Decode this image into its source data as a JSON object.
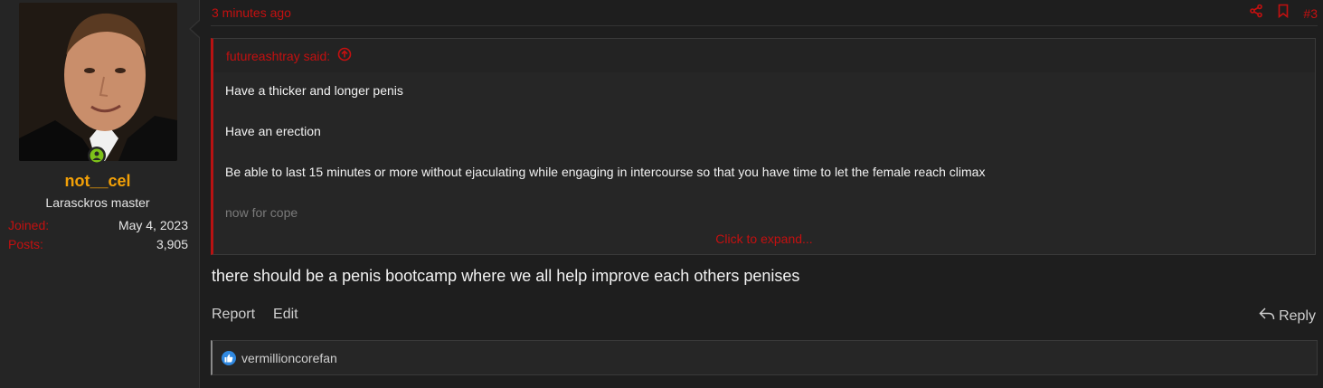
{
  "user": {
    "name": "not__cel",
    "title": "Larasckros master",
    "joined_label": "Joined:",
    "joined_value": "May 4, 2023",
    "posts_label": "Posts:",
    "posts_value": "3,905"
  },
  "post": {
    "time": "3 minutes ago",
    "number": "#3",
    "quote": {
      "author": "futureashtray said:",
      "lines": [
        "Have a thicker and longer penis",
        "Have an erection",
        "Be able to last 15 minutes or more without ejaculating while engaging in intercourse so that you have time to let the female reach climax",
        "now for cope"
      ],
      "expand": "Click to expand..."
    },
    "body": "there should be a penis bootcamp where we all help improve each others penises",
    "actions": {
      "report": "Report",
      "edit": "Edit",
      "reply": "Reply"
    },
    "reactions": {
      "users": "vermillioncorefan"
    }
  },
  "colors": {
    "accent": "#c41010",
    "username": "#f2a007",
    "like": "#2f88e0",
    "online": "#7dc11a"
  },
  "icons": [
    "online-status-icon",
    "share-icon",
    "bookmark-icon",
    "quote-up-icon",
    "reply-icon",
    "like-icon"
  ]
}
